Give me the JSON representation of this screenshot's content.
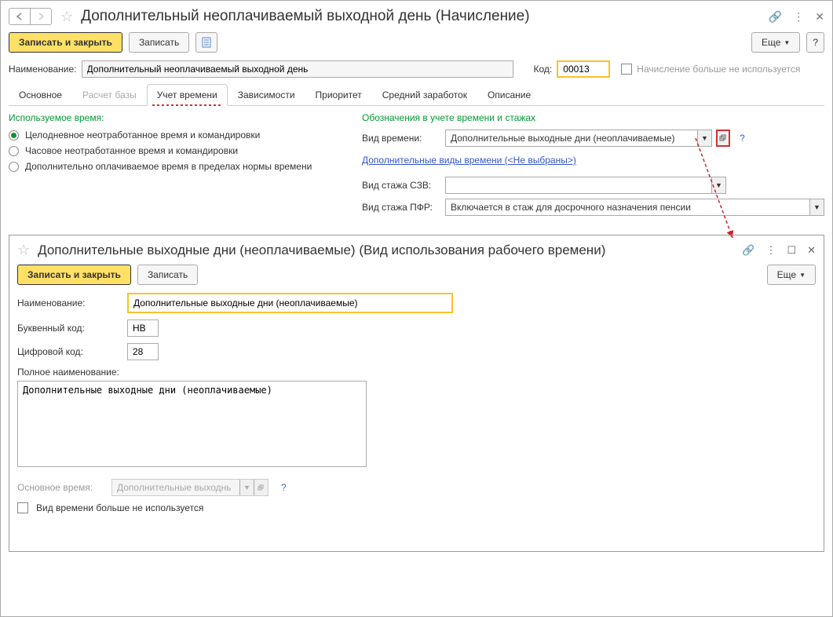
{
  "header": {
    "title": "Дополнительный неоплачиваемый выходной день (Начисление)"
  },
  "toolbar": {
    "save_close": "Записать и закрыть",
    "save": "Записать",
    "more": "Еще",
    "help": "?"
  },
  "main_form": {
    "name_label": "Наименование:",
    "name_value": "Дополнительный неоплачиваемый выходной день",
    "code_label": "Код:",
    "code_value": "00013",
    "not_used_label": "Начисление больше не используется"
  },
  "tabs": [
    "Основное",
    "Расчет базы",
    "Учет времени",
    "Зависимости",
    "Приоритет",
    "Средний заработок",
    "Описание"
  ],
  "left_section": {
    "header": "Используемое время:",
    "options": [
      "Целодневное неотработанное время и командировки",
      "Часовое неотработанное время и командировки",
      "Дополнительно оплачиваемое время в пределах нормы времени"
    ]
  },
  "right_section": {
    "header": "Обозначения в учете времени и стажах",
    "time_type_label": "Вид времени:",
    "time_type_value": "Дополнительные выходные дни (неоплачиваемые)",
    "additional_link": "Дополнительные виды времени (<Не выбраны>)",
    "szv_label": "Вид стажа СЗВ:",
    "szv_value": "",
    "pfr_label": "Вид стажа ПФР:",
    "pfr_value": "Включается в стаж для досрочного назначения пенсии"
  },
  "sub": {
    "title": "Дополнительные выходные дни (неоплачиваемые) (Вид использования рабочего времени)",
    "save_close": "Записать и закрыть",
    "save": "Записать",
    "more": "Еще",
    "name_label": "Наименование:",
    "name_value": "Дополнительные выходные дни (неоплачиваемые)",
    "letter_label": "Буквенный код:",
    "letter_value": "НВ",
    "digit_label": "Цифровой код:",
    "digit_value": "28",
    "full_label": "Полное наименование:",
    "full_value": "Дополнительные выходные дни (неоплачиваемые)",
    "base_label": "Основное время:",
    "base_value": "Дополнительные выходнь",
    "not_used": "Вид времени больше не используется"
  }
}
